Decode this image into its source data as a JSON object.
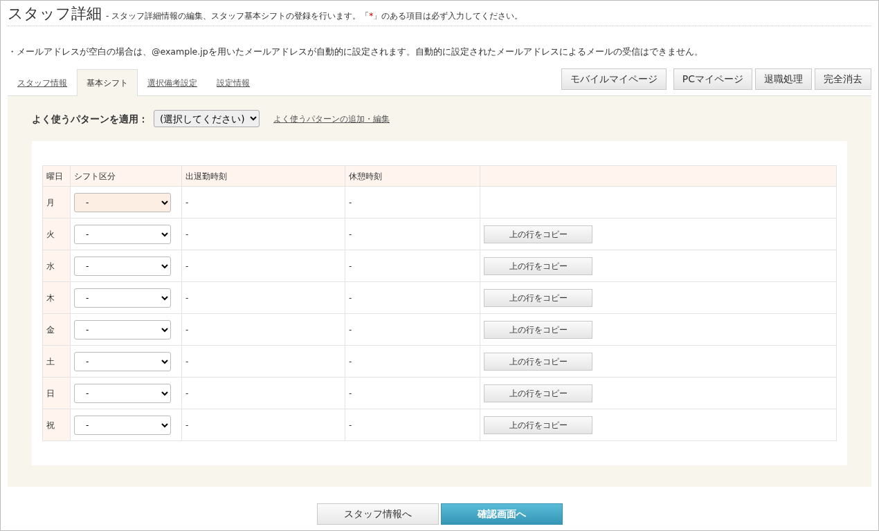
{
  "header": {
    "title": "スタッフ詳細",
    "subtitle": {
      "before": "- スタッフ詳細情報の編集、スタッフ基本シフトの登録を行います。「",
      "mark": "*",
      "after": "」のある項目は必ず入力してください。"
    }
  },
  "notice": "・メールアドレスが空白の場合は、@example.jpを用いたメールアドレスが自動的に設定されます。自動的に設定されたメールアドレスによるメールの受信はできません。",
  "tabs": [
    {
      "label": "スタッフ情報",
      "selected": false
    },
    {
      "label": "基本シフト",
      "selected": true
    },
    {
      "label": "選択備考設定",
      "selected": false
    },
    {
      "label": "設定情報",
      "selected": false
    }
  ],
  "action_buttons": [
    "モバイルマイページ",
    "PCマイページ",
    "退職処理",
    "完全消去"
  ],
  "pattern": {
    "label": "よく使うパターンを適用：",
    "select_value": "(選択してください)",
    "link": "よく使うパターンの追加・編集"
  },
  "table": {
    "columns": [
      "曜日",
      "シフト区分",
      "出退勤時刻",
      "休憩時刻"
    ],
    "rows": [
      {
        "day": "月",
        "shift": "-",
        "highlighted": true,
        "work_time": "-",
        "break_time": "-"
      },
      {
        "day": "火",
        "shift": "-",
        "highlighted": false,
        "work_time": "-",
        "break_time": "-",
        "copy_button": "上の行をコピー"
      },
      {
        "day": "水",
        "shift": "-",
        "highlighted": false,
        "work_time": "-",
        "break_time": "-",
        "copy_button": "上の行をコピー"
      },
      {
        "day": "木",
        "shift": "-",
        "highlighted": false,
        "work_time": "-",
        "break_time": "-",
        "copy_button": "上の行をコピー"
      },
      {
        "day": "金",
        "shift": "-",
        "highlighted": false,
        "work_time": "-",
        "break_time": "-",
        "copy_button": "上の行をコピー"
      },
      {
        "day": "土",
        "shift": "-",
        "highlighted": false,
        "work_time": "-",
        "break_time": "-",
        "copy_button": "上の行をコピー"
      },
      {
        "day": "日",
        "shift": "-",
        "highlighted": false,
        "work_time": "-",
        "break_time": "-",
        "copy_button": "上の行をコピー"
      },
      {
        "day": "祝",
        "shift": "-",
        "highlighted": false,
        "work_time": "-",
        "break_time": "-",
        "copy_button": "上の行をコピー"
      }
    ]
  },
  "footer_buttons": [
    {
      "label": "スタッフ情報へ",
      "kind": "secondary"
    },
    {
      "label": "確認画面へ",
      "kind": "primary"
    }
  ]
}
